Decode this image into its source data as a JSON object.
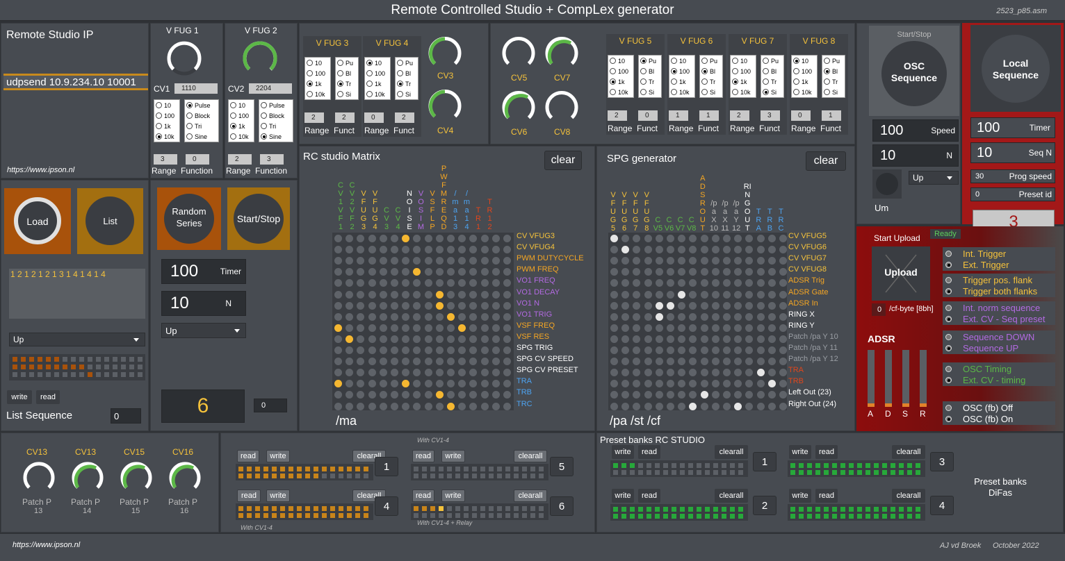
{
  "header": {
    "title": "Remote Controlled Studio + CompLex generator",
    "file": "2523_p85.asm"
  },
  "footer": {
    "url": "https://www.ipson.nl",
    "author": "AJ vd Broek",
    "date": "October 2022"
  },
  "ip": {
    "title": "Remote Studio IP",
    "cmd": "udpsend 10.9.234.10 10001",
    "url": "https://www.ipson.nl"
  },
  "fug1": {
    "title": "V  FUG 1",
    "cv": "CV1",
    "cv_val": "1110",
    "range": "3",
    "func": "0",
    "range_label": "Range",
    "func_label": "Function"
  },
  "fug2": {
    "title": "V  FUG 2",
    "cv": "CV2",
    "cv_val": "2204",
    "range": "2",
    "func": "3",
    "range_label": "Range",
    "func_label": "Function"
  },
  "radio_range": [
    "10",
    "100",
    "1k",
    "10k"
  ],
  "radio_func_long": [
    "Pulse",
    "Block",
    "Tri",
    "Sine"
  ],
  "radio_func_short": [
    "Pu",
    "Bl",
    "Tr",
    "Si"
  ],
  "fugs": [
    {
      "title": "V  FUG 3",
      "range": "2",
      "func": "2"
    },
    {
      "title": "V  FUG 4",
      "range": "0",
      "func": "2"
    },
    {
      "title": "V  FUG 5",
      "range": "2",
      "func": "0"
    },
    {
      "title": "V  FUG 6",
      "range": "1",
      "func": "1"
    },
    {
      "title": "V  FUG 7",
      "range": "2",
      "func": "3"
    },
    {
      "title": "V  FUG 8",
      "range": "0",
      "func": "1"
    }
  ],
  "small_labels": {
    "range": "Range",
    "funct": "Funct"
  },
  "cv_knobs": {
    "cv3": "CV3",
    "cv4": "CV4",
    "cv5": "CV5",
    "cv6": "CV6",
    "cv7": "CV7",
    "cv8": "CV8"
  },
  "load": {
    "load": "Load",
    "list": "List",
    "sequence": "1 2 1 2 1 2 1 3 1 4 1 4 1 4",
    "direction": "Up",
    "write": "write",
    "read": "read",
    "list_seq": "List Sequence",
    "list_seq_val": "0"
  },
  "random": {
    "random": "Random Series",
    "startstop": "Start/Stop",
    "timer": "100",
    "timer_label": "Timer",
    "n": "10",
    "n_label": "N",
    "direction": "Up",
    "big": "6",
    "small": "0"
  },
  "matrix": {
    "title": "RC studio Matrix",
    "clear": "clear",
    "bottom": "/ma",
    "cols": [
      [
        "C",
        "V",
        "1",
        "",
        "V",
        "F",
        "1"
      ],
      [
        "C",
        "V",
        "2",
        "",
        "V",
        "F",
        "2"
      ],
      [
        "V",
        "F",
        "U",
        "G",
        "3"
      ],
      [
        "V",
        "F",
        "U",
        "G",
        "4"
      ],
      [
        "C",
        "V",
        "3"
      ],
      [
        "C",
        "V",
        "4"
      ],
      [
        "N",
        "O",
        "I",
        "S",
        "E"
      ],
      [
        "V",
        "O",
        "S",
        "I",
        "M"
      ],
      [
        "V",
        "S",
        "F",
        "L",
        "P"
      ],
      [
        "P",
        "W",
        "F",
        "M",
        "R",
        "E",
        "Q",
        "D"
      ],
      [
        "/",
        "m",
        "a",
        "",
        "1",
        "3"
      ],
      [
        "/",
        "m",
        "a",
        "",
        "1",
        "4"
      ],
      [
        "T",
        "R",
        "1"
      ],
      [
        "T",
        "R",
        "1",
        "2"
      ]
    ],
    "rows": [
      {
        "t": "CV VFUG3",
        "c": "#f5c23b"
      },
      {
        "t": "CV VFUG4",
        "c": "#f5c23b"
      },
      {
        "t": "PWM DUTYCYCLE",
        "c": "#f5a623"
      },
      {
        "t": "PWM FREQ",
        "c": "#f5a623"
      },
      {
        "t": "VO1 FREQ",
        "c": "#b36ae2"
      },
      {
        "t": "VO1 DECAY",
        "c": "#b36ae2"
      },
      {
        "t": "VO1 N",
        "c": "#b36ae2"
      },
      {
        "t": "VO1 TRIG",
        "c": "#b36ae2"
      },
      {
        "t": "VSF FREQ",
        "c": "#f5a623"
      },
      {
        "t": "VSF RES",
        "c": "#f5a623"
      },
      {
        "t": "SPG TRIG",
        "c": "#ffffff"
      },
      {
        "t": "SPG CV SPEED",
        "c": "#ffffff"
      },
      {
        "t": "SPG CV PRESET",
        "c": "#ffffff"
      },
      {
        "t": "TRA",
        "c": "#4da3f0"
      },
      {
        "t": "TRB",
        "c": "#4da3f0"
      },
      {
        "t": "TRC",
        "c": "#4da3f0"
      }
    ],
    "on": [
      [
        0,
        6
      ],
      [
        3,
        7
      ],
      [
        5,
        9
      ],
      [
        6,
        9
      ],
      [
        7,
        10
      ],
      [
        8,
        0
      ],
      [
        8,
        11
      ],
      [
        9,
        1
      ],
      [
        13,
        0
      ],
      [
        13,
        6
      ],
      [
        14,
        9
      ],
      [
        15,
        10
      ]
    ]
  },
  "spg": {
    "title": "SPG generator",
    "clear": "clear",
    "bottom": "/pa /st /cf",
    "cols": [
      "VFUG5",
      "VFUG6",
      "VFUG7",
      "VFUG8",
      "CV5",
      "CV6",
      "CV7",
      "CV8",
      "ADSR OUT",
      "/pa X 10",
      "/pa X 11",
      "/pa Y 12",
      "RING OUT",
      "TRA",
      "TRB",
      "TRC"
    ],
    "rows": [
      {
        "t": "CV VFUG5",
        "c": "#f5c23b"
      },
      {
        "t": "CV VFUG6",
        "c": "#f5c23b"
      },
      {
        "t": "CV VFUG7",
        "c": "#f5c23b"
      },
      {
        "t": "CV VFUG8",
        "c": "#f5c23b"
      },
      {
        "t": "ADSR Trig",
        "c": "#f5a623"
      },
      {
        "t": "ADSR Gate",
        "c": "#f5a623"
      },
      {
        "t": "ADSR In",
        "c": "#f5a623"
      },
      {
        "t": "RING X",
        "c": "#ffffff"
      },
      {
        "t": "RING Y",
        "c": "#ffffff"
      },
      {
        "t": "Patch /pa Y 10",
        "c": "#9a9ea4"
      },
      {
        "t": "Patch /pa Y 11",
        "c": "#9a9ea4"
      },
      {
        "t": "Patch /pa Y 12",
        "c": "#9a9ea4"
      },
      {
        "t": "TRA",
        "c": "#e0461c"
      },
      {
        "t": "TRB",
        "c": "#e0461c"
      },
      {
        "t": "Left Out (23)",
        "c": "#ffffff"
      },
      {
        "t": "Right Out (24)",
        "c": "#ffffff"
      }
    ],
    "on": [
      [
        0,
        0
      ],
      [
        1,
        1
      ],
      [
        5,
        6
      ],
      [
        6,
        4
      ],
      [
        6,
        5
      ],
      [
        7,
        4
      ],
      [
        12,
        13
      ],
      [
        13,
        14
      ],
      [
        14,
        8
      ],
      [
        15,
        7
      ],
      [
        15,
        11
      ]
    ]
  },
  "osc": {
    "startstop": "Start/Stop",
    "label": "OSC Sequence",
    "speed": "100",
    "speed_label": "Speed",
    "n": "10",
    "n_label": "N",
    "direction": "Up",
    "um": "Um"
  },
  "local": {
    "label": "Local Sequence",
    "timer": "100",
    "timer_label": "Timer",
    "seqn": "10",
    "seqn_label": "Seq N",
    "prog": "30",
    "prog_label": "Prog speed",
    "preset": "0",
    "preset_label": "Preset id",
    "big": "3"
  },
  "upload": {
    "start": "Start Upload",
    "ready": "Ready",
    "upload": "Upload",
    "cfbyte": "0",
    "cf_label": "/cf-byte [8bh]",
    "adsr": "ADSR",
    "opts": [
      [
        "Int. Trigger",
        "Ext. Trigger"
      ],
      [
        "Trigger pos. flank",
        "Trigger both flanks"
      ],
      [
        "Int. norm sequence",
        "Ext. CV - Seq preset"
      ],
      [
        "Sequence DOWN",
        "Sequence UP"
      ],
      [
        "OSC Timing",
        "Ext. CV - timing"
      ],
      [
        "OSC (fb) Off",
        "OSC (fb) On"
      ]
    ],
    "faders": [
      "A",
      "D",
      "S",
      "R"
    ]
  },
  "cvbottom": [
    {
      "t": "CV13",
      "p": "Patch P",
      "n": "13"
    },
    {
      "t": "CV13",
      "p": "Patch P",
      "n": "14"
    },
    {
      "t": "CV15",
      "p": "Patch P",
      "n": "15"
    },
    {
      "t": "CV16",
      "p": "Patch P",
      "n": "16"
    }
  ],
  "banks": {
    "read": "read",
    "write": "write",
    "clearall": "clearall",
    "with14": "With CV1-4",
    "with14r": "With CV1-4 + Relay",
    "nums": [
      "1",
      "4",
      "5",
      "6"
    ]
  },
  "preset": {
    "title": "Preset banks RC STUDIO",
    "nums": [
      "1",
      "2",
      "3",
      "4"
    ],
    "difas": "Preset banks DiFas"
  },
  "colors": {
    "panel": "#474b51",
    "accent": "#f5c23b",
    "orange": "#a8520b",
    "red": "#a31818"
  }
}
